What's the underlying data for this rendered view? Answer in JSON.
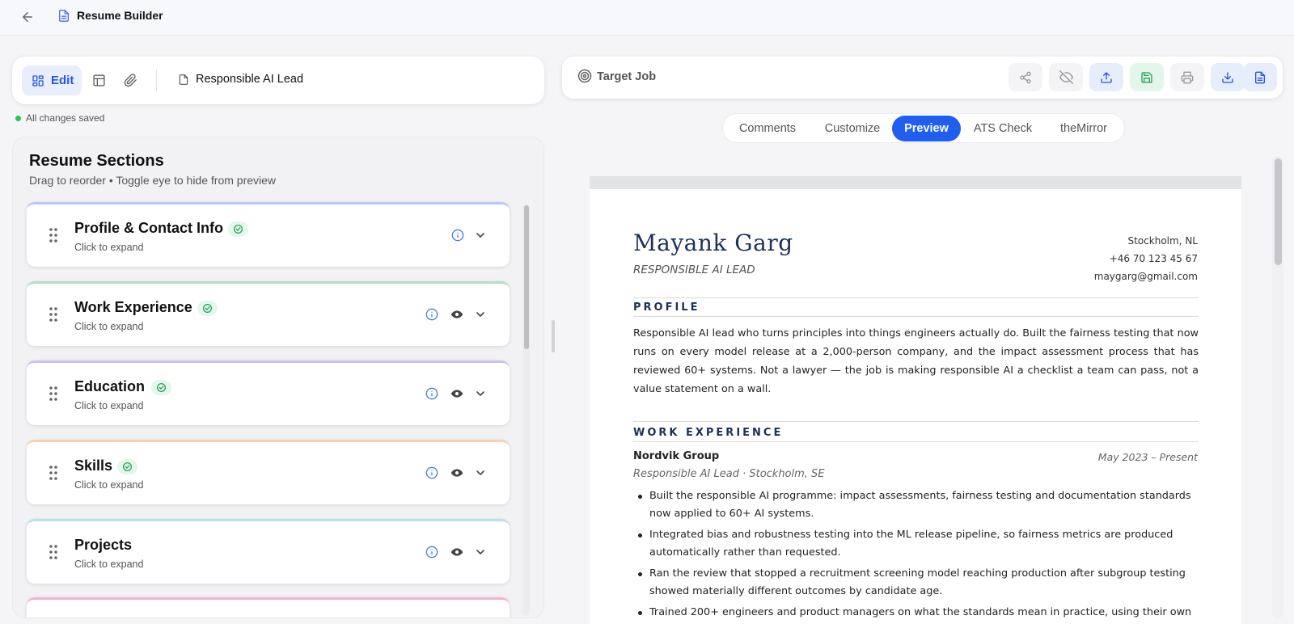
{
  "app": {
    "title": "Resume Builder"
  },
  "left_toolbar": {
    "edit_label": "Edit",
    "document_name": "Responsible AI Lead"
  },
  "save_status": "All changes saved",
  "sections_panel": {
    "title": "Resume Sections",
    "subtitle": "Drag to reorder • Toggle eye to hide from preview",
    "hint": "Click to expand",
    "items": [
      {
        "label": "Profile & Contact Info",
        "accent": "#b9c9f5"
      },
      {
        "label": "Work Experience",
        "accent": "#b3e0c9"
      },
      {
        "label": "Education",
        "accent": "#cfc0f2"
      },
      {
        "label": "Skills",
        "accent": "#f6d3ad"
      },
      {
        "label": "Projects",
        "accent": "#b7e0ef"
      }
    ]
  },
  "right_toolbar": {
    "target_label": "Target Job"
  },
  "tabs": [
    "Comments",
    "Customize",
    "Preview",
    "ATS Check",
    "theMirror"
  ],
  "active_tab": "Preview",
  "colors": {
    "accent": "#1f5ef0",
    "resume_heading": "#1b3159",
    "saved": "#22c55e"
  },
  "resume": {
    "name": "Mayank Garg",
    "title": "RESPONSIBLE AI LEAD",
    "location": "Stockholm, NL",
    "phone": "+46 70 123 45 67",
    "email": "maygarg@gmail.com",
    "profile_heading": "PROFILE",
    "profile": "Responsible AI lead who turns principles into things engineers actually do. Built the fairness testing that now runs on every model release at a 2,000-person company, and the impact assessment process that has reviewed 60+ systems. Not a lawyer — the job is making responsible AI a checklist a team can pass, not a value statement on a wall.",
    "work_heading": "WORK EXPERIENCE",
    "job": {
      "company": "Nordvik Group",
      "dates": "May 2023 – Present",
      "role": "Responsible AI Lead · Stockholm, SE",
      "bullets": [
        "Built the responsible AI programme: impact assessments, fairness testing and documentation standards now applied to 60+ AI systems.",
        "Integrated bias and robustness testing into the ML release pipeline, so fairness metrics are produced automatically rather than requested.",
        "Ran the review that stopped a recruitment screening model reaching production after subgroup testing showed materially different outcomes by candidate age.",
        "Trained 200+ engineers and product managers on what the standards mean in practice, using their own"
      ]
    }
  }
}
